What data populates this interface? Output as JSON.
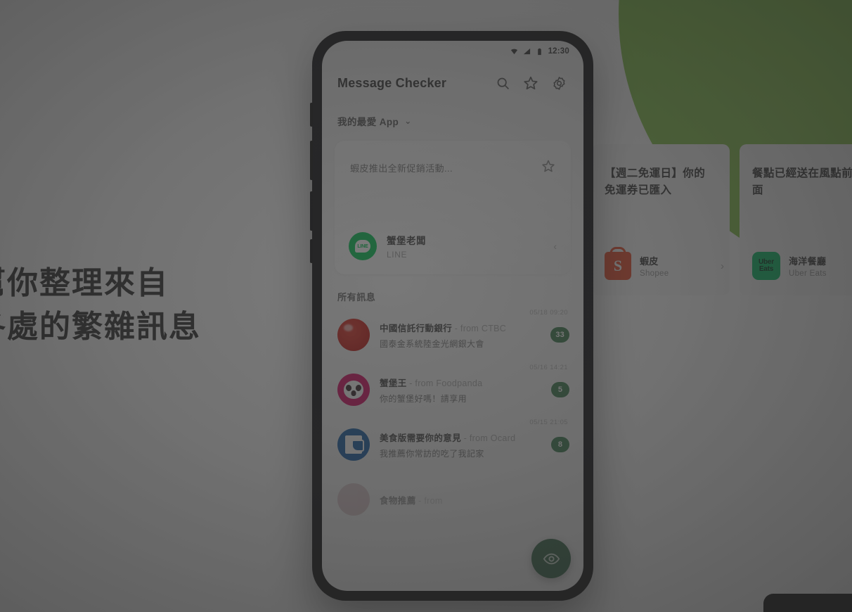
{
  "hero": {
    "line1": "幫你整理來自",
    "line2": "各處的繁雜訊息"
  },
  "promo_cards": [
    {
      "headline": "【週二免運日】你的\n免運券已匯入",
      "app_title": "蝦皮",
      "app_sub": "Shopee",
      "icon": "shopee-icon",
      "icon_letter": "S",
      "chevron": "›"
    },
    {
      "headline": "餐點已經送在風點前\n面",
      "app_title": "海洋餐廳",
      "app_sub": "Uber Eats",
      "icon": "ubereats-icon",
      "icon_line1": "Uber",
      "icon_line2": "Eats",
      "chevron": "›"
    }
  ],
  "phone": {
    "statusbar": {
      "wifi_icon": "wifi-icon",
      "signal_icon": "signal-icon",
      "battery_icon": "battery-icon",
      "time": "12:30"
    },
    "appbar": {
      "title": "Message Checker",
      "actions": [
        {
          "name": "search-icon",
          "label": "Search"
        },
        {
          "name": "star-icon",
          "label": "Favourites"
        },
        {
          "name": "settings-icon",
          "label": "Settings"
        }
      ]
    },
    "favourites": {
      "section_label": "我的最愛 App",
      "chevron": "⌄",
      "card": {
        "preview_text": "蝦皮推出全新促銷活動...",
        "star_icon": "star-outline-icon",
        "app_name": "蟹堡老闆",
        "app_source": "LINE",
        "chevron": "‹",
        "app_icon": "line-icon",
        "app_icon_text": "LINE"
      }
    },
    "messages": {
      "section_label": "所有訊息",
      "items": [
        {
          "time": "05/18  09:20",
          "name": "中國信託行動銀行",
          "from": "- from CTBC",
          "preview": "國泰金系統陸金光網銀大會",
          "badge": "33",
          "avatar": "ctbc-avatar"
        },
        {
          "time": "05/16  14:21",
          "name": "蟹堡王",
          "from": "- from Foodpanda",
          "preview": "你的蟹堡好嗎！請享用",
          "badge": "5",
          "avatar": "foodpanda-avatar"
        },
        {
          "time": "05/15  21:05",
          "name": "美食版需要你的意見",
          "from": "- from Ocard",
          "preview": "我推薦你常訪的吃了我記家",
          "badge": "8",
          "avatar": "ocard-avatar"
        },
        {
          "time": "",
          "name": "食物推薦",
          "from": "- from",
          "preview": "",
          "badge": "",
          "avatar": "partial-avatar"
        }
      ]
    },
    "fab": {
      "icon": "eye-icon",
      "label": "Preview"
    }
  },
  "colors": {
    "brand_green": "#7dc242",
    "line_green": "#06c755",
    "shopee_orange": "#ee4d2d",
    "ubereats_green": "#06c167",
    "foodpanda_pink": "#d70f64",
    "badge_green": "#3f7f52",
    "ctbc_red": "#c41f1a",
    "ocard_blue": "#1a5fa8"
  }
}
